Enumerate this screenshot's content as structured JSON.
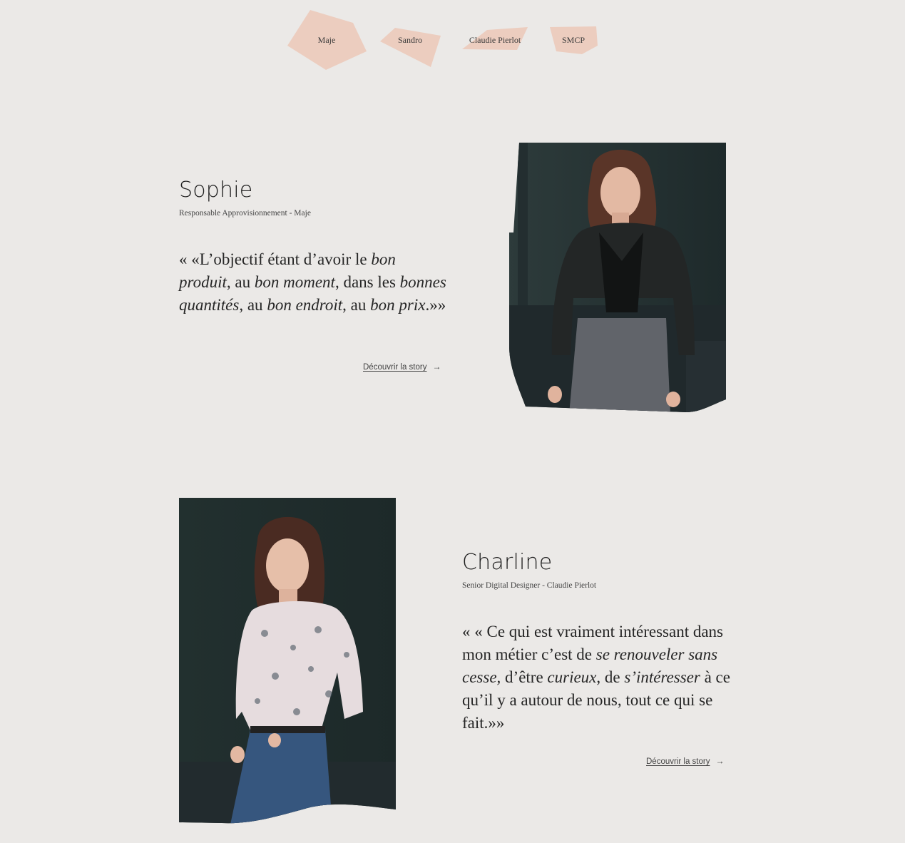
{
  "nav": {
    "items": [
      {
        "label": "Maje"
      },
      {
        "label": "Sandro"
      },
      {
        "label": "Claudie Pierlot"
      },
      {
        "label": "SMCP"
      }
    ],
    "shape_color": "#eccdbf"
  },
  "profiles": [
    {
      "name": "Sophie",
      "role": "Responsable Approvisionnement - Maje",
      "quote": {
        "segments": [
          {
            "text": "« «L’objectif étant d’avoir le ",
            "italic": false
          },
          {
            "text": "bon produit",
            "italic": true
          },
          {
            "text": ", au ",
            "italic": false
          },
          {
            "text": "bon moment",
            "italic": true
          },
          {
            "text": ", dans les ",
            "italic": false
          },
          {
            "text": "bonnes quantités",
            "italic": true
          },
          {
            "text": ", au ",
            "italic": false
          },
          {
            "text": "bon endroit",
            "italic": true
          },
          {
            "text": ", au ",
            "italic": false
          },
          {
            "text": "bon prix",
            "italic": true
          },
          {
            "text": ".»»",
            "italic": false
          }
        ]
      },
      "cta": "Découvrir la story",
      "photo": {
        "bg": "#243232",
        "icon": "portrait-photo"
      }
    },
    {
      "name": "Charline",
      "role": "Senior Digital Designer - Claudie Pierlot",
      "quote": {
        "segments": [
          {
            "text": "« « Ce qui est vraiment intéressant dans mon métier c’est de ",
            "italic": false
          },
          {
            "text": "se renouveler sans cesse,",
            "italic": true
          },
          {
            "text": " d’être ",
            "italic": false
          },
          {
            "text": "curieux",
            "italic": true
          },
          {
            "text": ", de ",
            "italic": false
          },
          {
            "text": "s’intéresser",
            "italic": true
          },
          {
            "text": " à ce qu’il y a autour de nous, tout ce qui se fait.»»",
            "italic": false
          }
        ]
      },
      "cta": "Découvrir la story",
      "photo": {
        "bg": "#233030",
        "icon": "portrait-photo"
      }
    }
  ]
}
